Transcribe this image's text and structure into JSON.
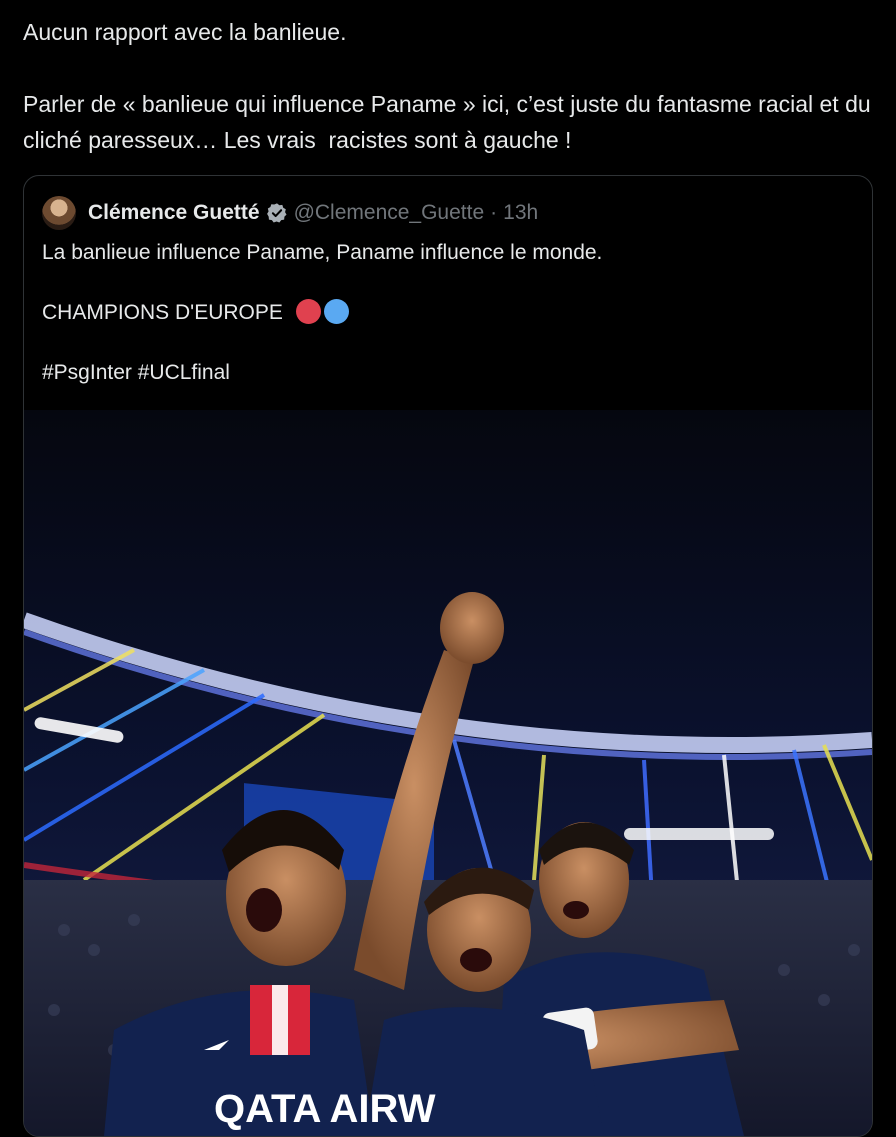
{
  "tweet": {
    "line1": "Aucun rapport avec la banlieue.",
    "line2": "Parler de « banlieue qui influence Paname » ici, c’est juste du fantasme racial et du cliché paresseux… Les vrais  racistes sont à gauche !"
  },
  "quote": {
    "name": "Clémence Guetté",
    "handle": "@Clemence_Guette",
    "separator": "·",
    "time": "13h",
    "text_line1": "La banlieue influence Paname, Paname influence le monde.",
    "text_line2": "CHAMPIONS D'EUROPE",
    "text_line3": "#PsgInter #UCLfinal",
    "emoji_colors": [
      "#e0414f",
      "#5aa9f2"
    ],
    "media_alt_text": "QATA AIRW"
  },
  "colors": {
    "background": "#000000",
    "text": "#e7e9ea",
    "muted": "#71767b",
    "border": "#2f3336",
    "psg_navy": "#12224f",
    "psg_red": "#d8263a"
  }
}
